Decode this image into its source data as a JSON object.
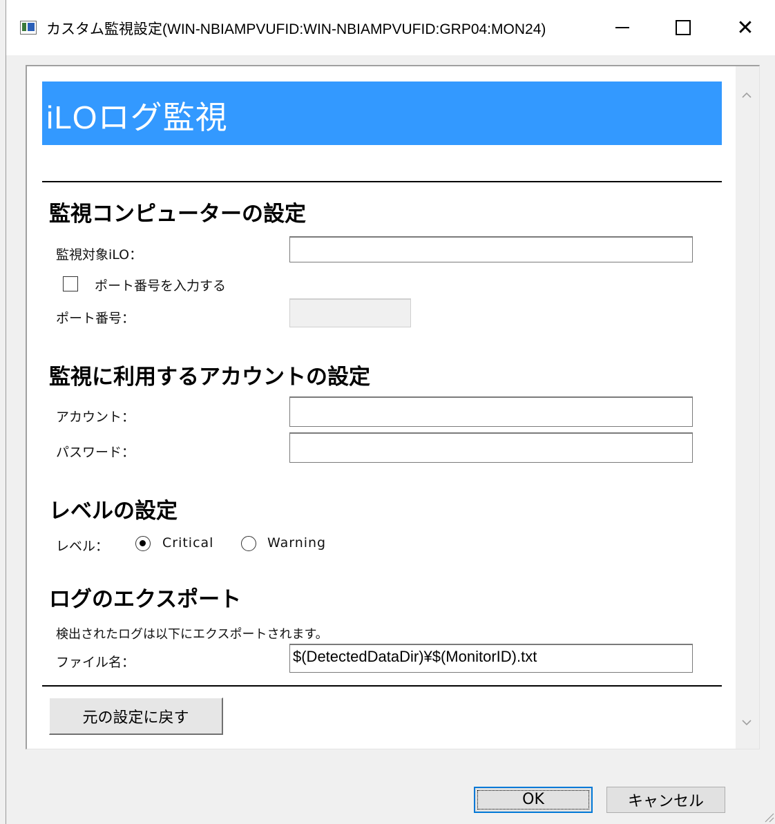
{
  "window": {
    "title": "カスタム監視設定(WIN-NBIAMPVUFID:WIN-NBIAMPVUFID:GRP04:MON24)",
    "minimize_glyph": "",
    "close_glyph": "✕"
  },
  "banner": {
    "title": "iLOログ監視"
  },
  "monitor_section": {
    "title": "監視コンピューターの設定",
    "target_label": "監視対象iLO：",
    "target_value": "",
    "port_checkbox_label": "ポート番号を入力する",
    "port_checkbox_checked": false,
    "port_label": "ポート番号：",
    "port_value": ""
  },
  "account_section": {
    "title": "監視に利用するアカウントの設定",
    "account_label": "アカウント：",
    "account_value": "",
    "password_label": "パスワード：",
    "password_value": ""
  },
  "level_section": {
    "title": "レベルの設定",
    "level_label": "レベル：",
    "options": [
      "Critical",
      "Warning"
    ],
    "selected": "Critical"
  },
  "export_section": {
    "title": "ログのエクスポート",
    "description": "検出されたログは以下にエクスポートされます。",
    "filename_label": "ファイル名：",
    "filename_value": "$(DetectedDataDir)¥$(MonitorID).txt"
  },
  "buttons": {
    "revert": "元の設定に戻す",
    "ok": "OK",
    "cancel": "キャンセル"
  },
  "icons": {
    "window_icon": "app-window-icon",
    "scroll_up": "chevron-up-icon",
    "scroll_down": "chevron-down-icon",
    "resize_grip": "resize-grip-icon"
  }
}
